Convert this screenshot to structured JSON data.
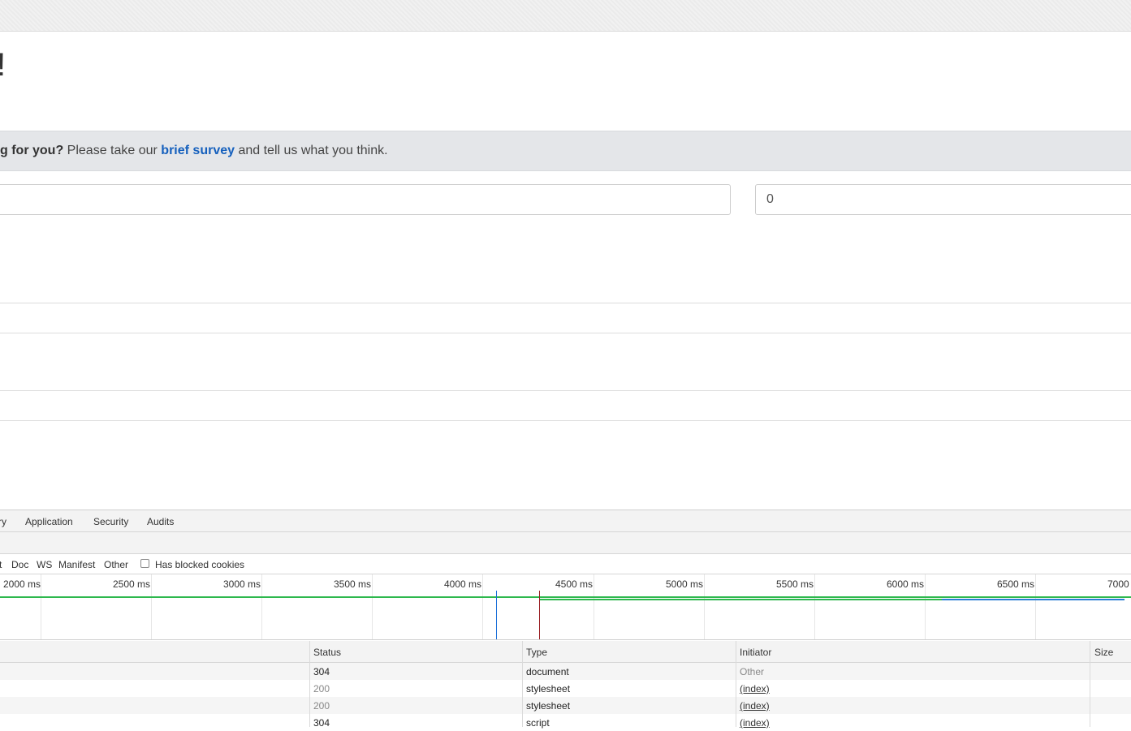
{
  "page": {
    "heading": "!",
    "banner": {
      "bold": "g for you?",
      "before_link": " Please take our ",
      "link": "brief survey",
      "after_link": " and tell us what you think."
    },
    "input2_value": "0"
  },
  "devtools": {
    "tabs": [
      "ry",
      "Application",
      "Security",
      "Audits"
    ],
    "filters": [
      "t",
      "Doc",
      "WS",
      "Manifest",
      "Other"
    ],
    "blocked_cookies_label": "Has blocked cookies",
    "timeline_ticks": [
      "2000 ms",
      "2500 ms",
      "3000 ms",
      "3500 ms",
      "4000 ms",
      "4500 ms",
      "5000 ms",
      "5500 ms",
      "6000 ms",
      "6500 ms",
      "7000"
    ],
    "columns": [
      "Status",
      "Type",
      "Initiator",
      "Size"
    ],
    "rows": [
      {
        "status": "304",
        "type": "document",
        "initiator": "Other"
      },
      {
        "status": "200",
        "type": "stylesheet",
        "initiator": "(index)"
      },
      {
        "status": "200",
        "type": "stylesheet",
        "initiator": "(index)"
      },
      {
        "status": "304",
        "type": "script",
        "initiator": "(index)"
      }
    ]
  },
  "colors": {
    "link": "#1560bd",
    "load_line": "#9b2226",
    "dom_line": "#1a6fd8",
    "bar_green": "#2db84d",
    "bar_blue": "#2a7fd4"
  }
}
